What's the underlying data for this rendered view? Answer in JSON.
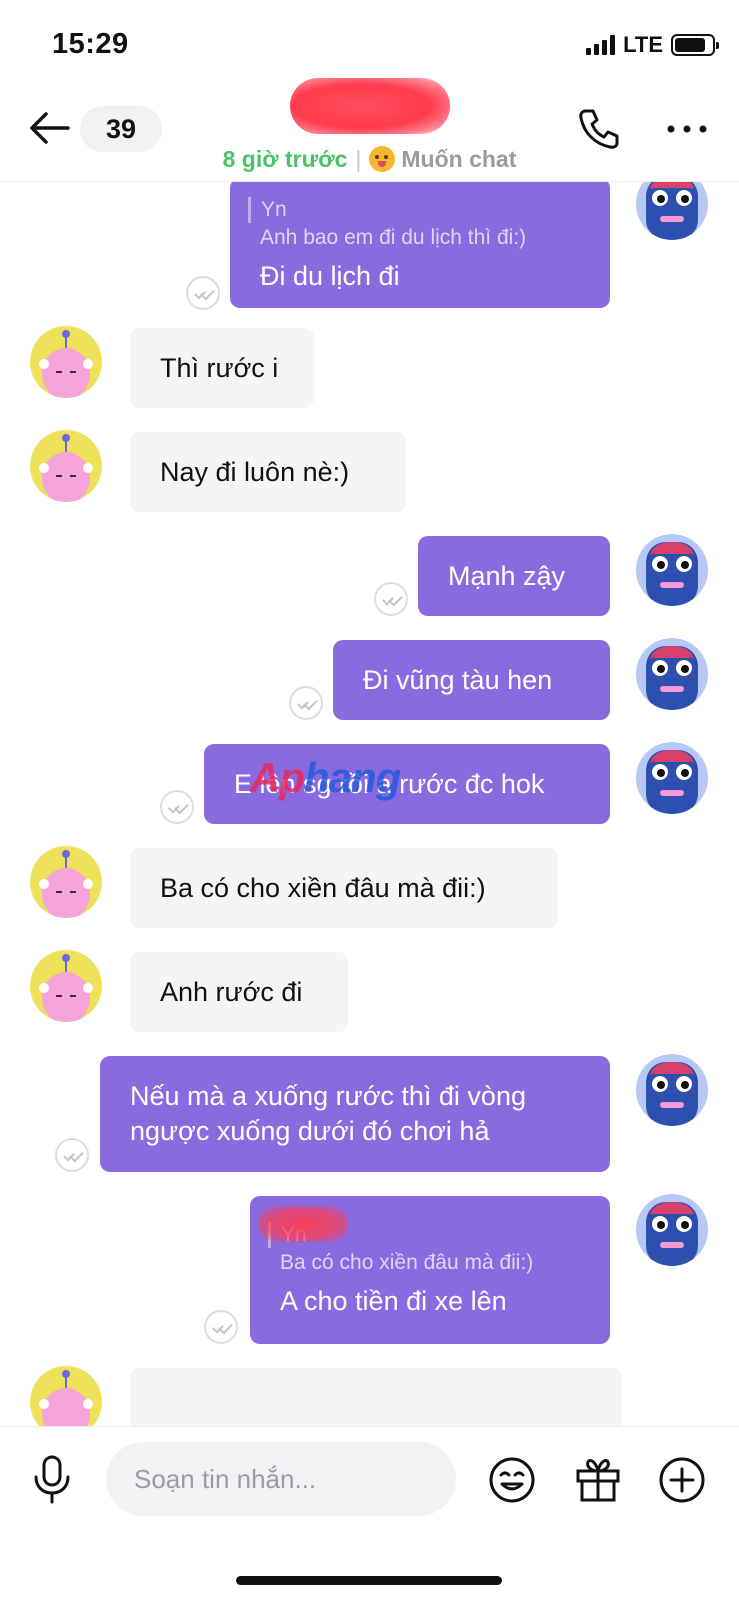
{
  "status_bar": {
    "time": "15:29",
    "network": "LTE"
  },
  "header": {
    "unread_count": "39",
    "contact_name": "",
    "last_active": "8 giờ trước",
    "separator": "|",
    "status_label": "Muốn chat",
    "icons": [
      "back-arrow-icon",
      "phone-icon",
      "more-dots-icon"
    ]
  },
  "messages": [
    {
      "from": "me",
      "reply_to_name": "Yn",
      "reply_quote": "Anh bao em đi du lịch thì đi:)",
      "text": "Đi du lịch đi",
      "seen": true
    },
    {
      "from": "them",
      "text": "Thì rước i"
    },
    {
      "from": "them",
      "text": "Nay đi luôn nè:)"
    },
    {
      "from": "me",
      "text": "Mạnh zậy",
      "seen": true
    },
    {
      "from": "me",
      "text": "Đi vũng tàu hen",
      "seen": true
    },
    {
      "from": "me",
      "text": "E lên sg rồi a rước đc hok",
      "seen": true
    },
    {
      "from": "them",
      "text": "Ba có cho xiền đâu mà đii:)"
    },
    {
      "from": "them",
      "text": "Anh rước đi"
    },
    {
      "from": "me",
      "text_line1": "Nếu mà a xuống rước thì đi vòng",
      "text_line2": "ngược xuống dưới đó chơi hả",
      "seen": true
    },
    {
      "from": "me",
      "reply_to_name": "Yn",
      "reply_quote": "Ba có cho xiền đâu mà đii:)",
      "text": "A cho tiền đi xe lên",
      "seen": true
    }
  ],
  "watermark": {
    "part1": "Ap",
    "part2": "hang"
  },
  "composer": {
    "placeholder": "Soạn tin nhắn...",
    "icons": [
      "microphone-icon",
      "emoji-icon",
      "gift-icon",
      "plus-circle-icon"
    ]
  },
  "colors": {
    "bubble_out": "#8a6bdf",
    "bubble_in": "#f5f5f7",
    "active_green": "#4bc26a",
    "avatar_me_bg": "#b8c8f5",
    "avatar_them_bg": "#efe15a"
  }
}
